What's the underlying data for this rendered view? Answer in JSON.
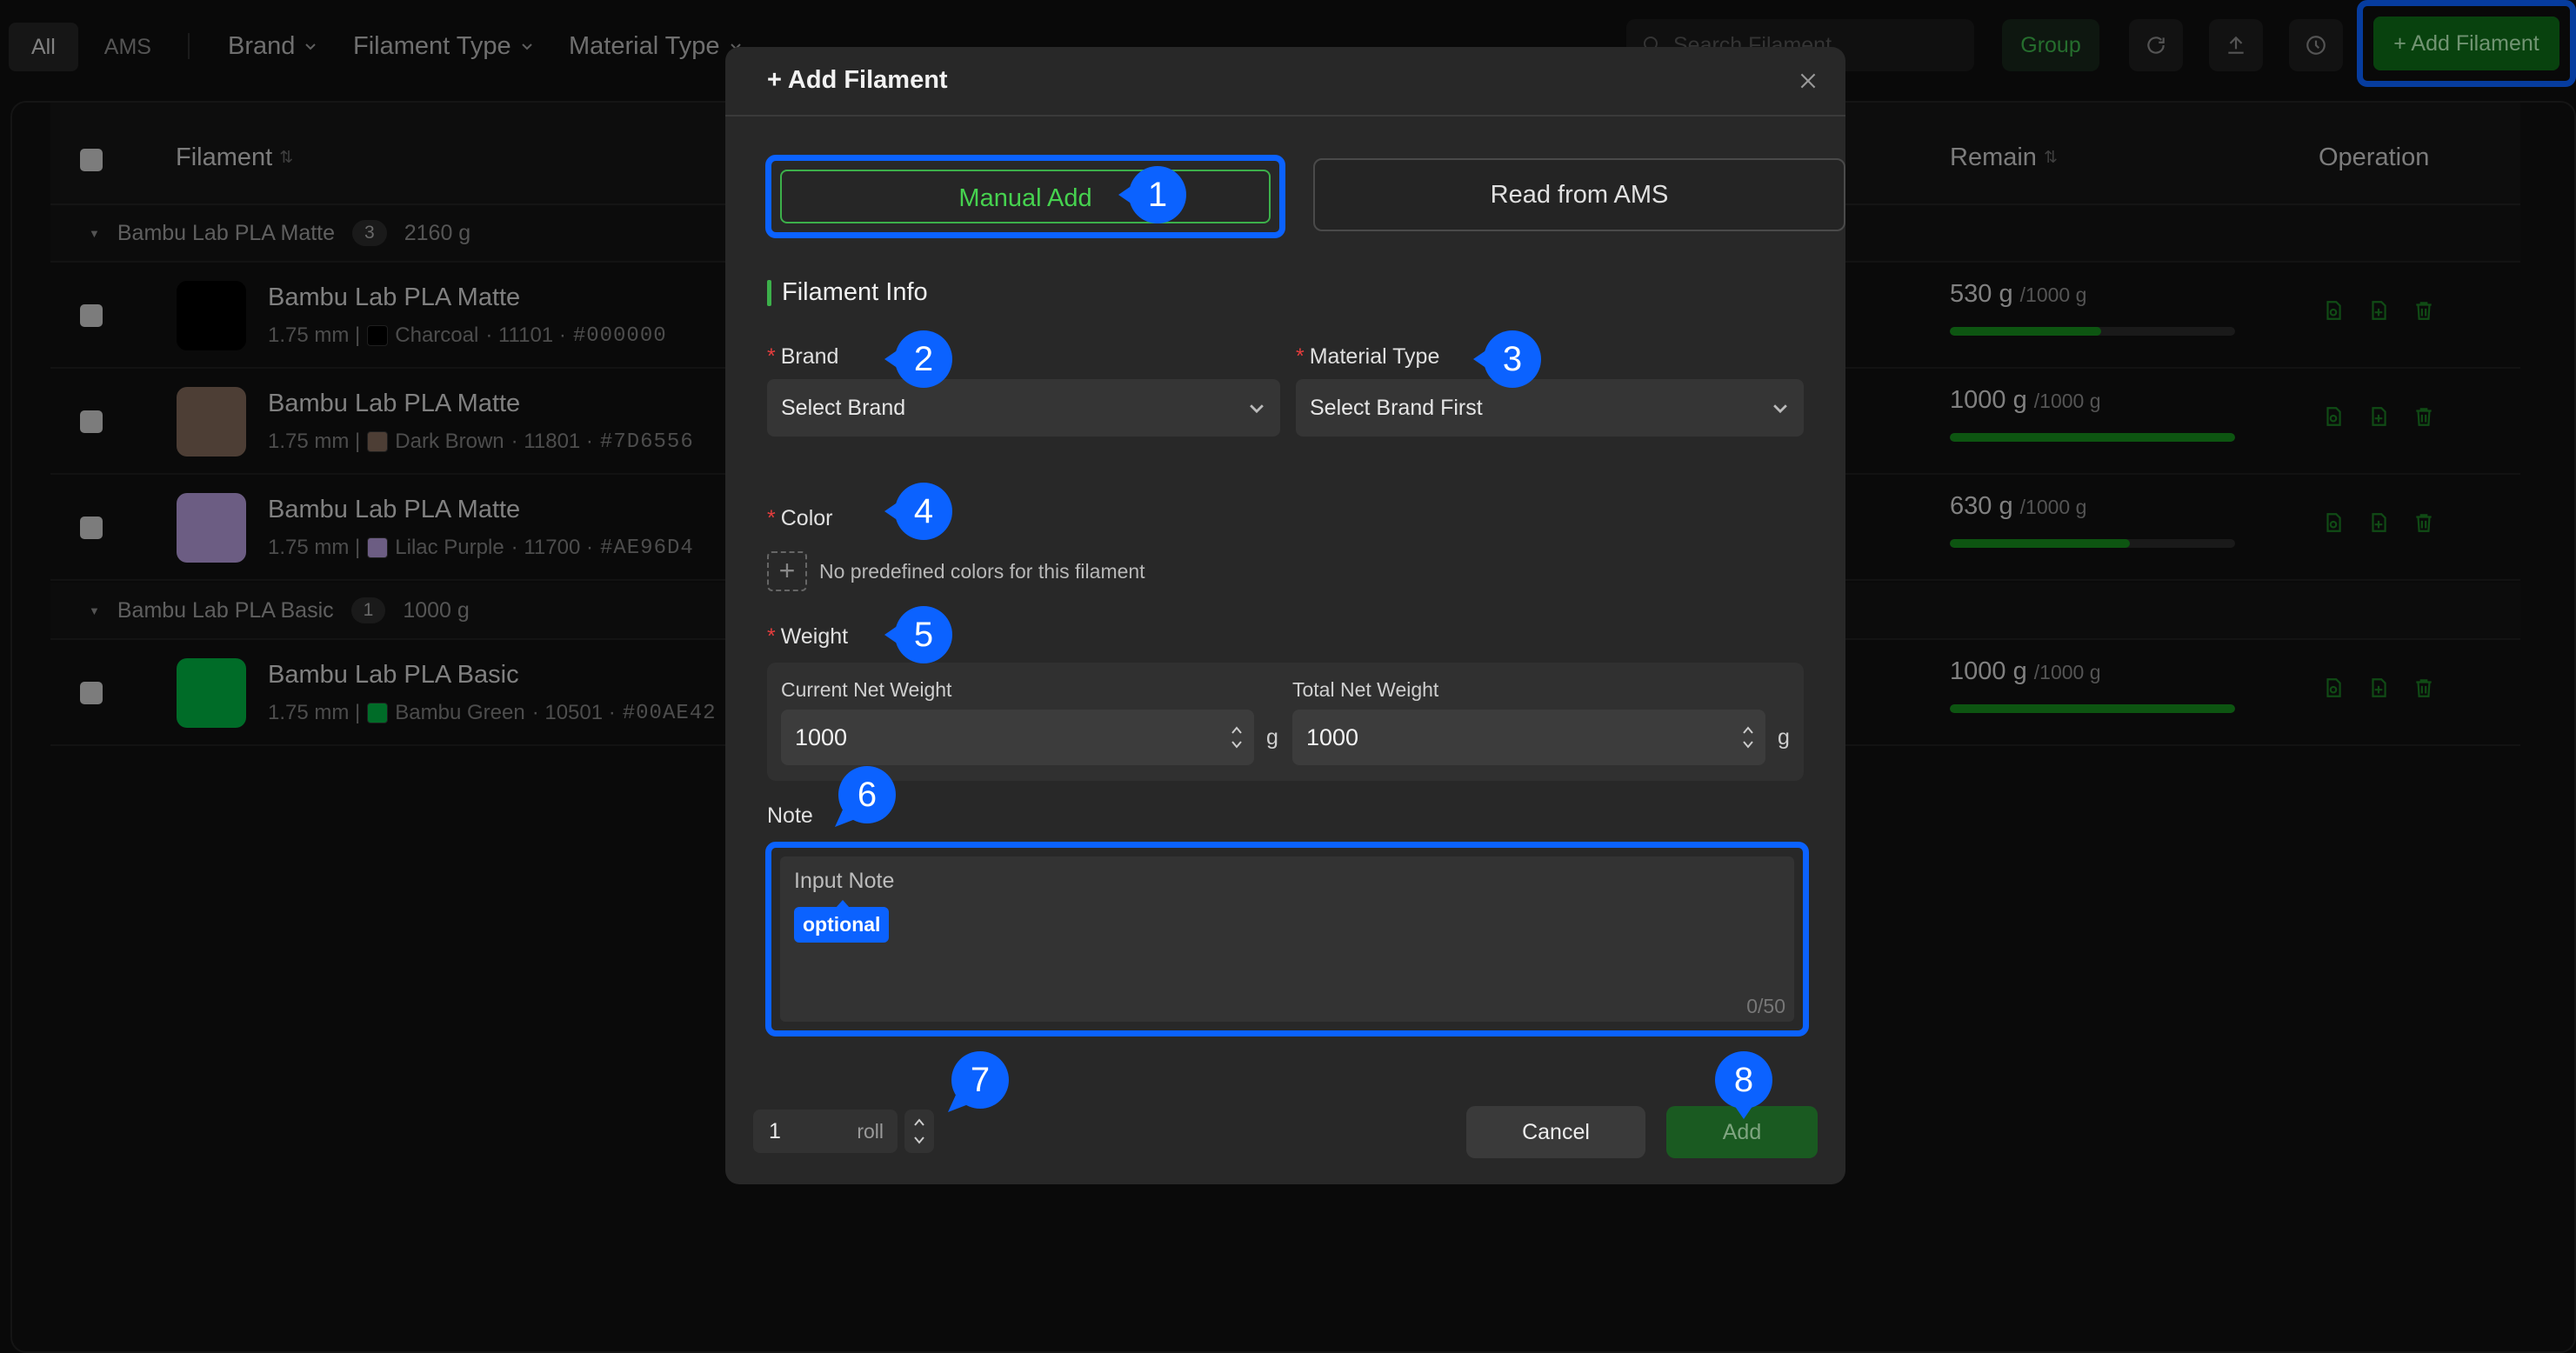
{
  "toolbar": {
    "tabs": [
      {
        "label": "All"
      },
      {
        "label": "AMS"
      }
    ],
    "filters": [
      {
        "label": "Brand"
      },
      {
        "label": "Filament Type"
      },
      {
        "label": "Material Type"
      }
    ],
    "search_placeholder": "Search Filament",
    "group_label": "Group",
    "add_filament_label": "+ Add Filament"
  },
  "table": {
    "headers": {
      "filament": "Filament",
      "remain": "Remain",
      "operation": "Operation"
    },
    "groups": [
      {
        "name": "Bambu Lab PLA Matte",
        "count": "3",
        "total": "2160 g"
      },
      {
        "name": "Bambu Lab PLA Basic",
        "count": "1",
        "total": "1000 g"
      }
    ],
    "rows": [
      {
        "name": "Bambu Lab PLA Matte",
        "diameter": "1.75 mm |",
        "color_name": "Charcoal",
        "code": "· 11101 ·",
        "hex": "#000000",
        "color": "#000000",
        "remain": "530 g",
        "capacity": "/1000 g",
        "fraction": 0.53
      },
      {
        "name": "Bambu Lab PLA Matte",
        "diameter": "1.75 mm |",
        "color_name": "Dark Brown",
        "code": "· 11801 ·",
        "hex": "#7D6556",
        "color": "#7D6556",
        "remain": "1000 g",
        "capacity": "/1000 g",
        "fraction": 1.0
      },
      {
        "name": "Bambu Lab PLA Matte",
        "diameter": "1.75 mm |",
        "color_name": "Lilac Purple",
        "code": "· 11700 ·",
        "hex": "#AE96D4",
        "color": "#AE96D4",
        "remain": "630 g",
        "capacity": "/1000 g",
        "fraction": 0.63
      },
      {
        "name": "Bambu Lab PLA Basic",
        "diameter": "1.75 mm |",
        "color_name": "Bambu Green",
        "code": "· 10501 ·",
        "hex": "#00AE42",
        "color": "#00AE42",
        "remain": "1000 g",
        "capacity": "/1000 g",
        "fraction": 1.0
      }
    ]
  },
  "modal": {
    "title": "+ Add Filament",
    "modes": {
      "manual": "Manual Add",
      "ams": "Read from AMS"
    },
    "section_title": "Filament Info",
    "brand": {
      "label": "Brand",
      "value": "Select Brand"
    },
    "material": {
      "label": "Material Type",
      "value": "Select Brand First"
    },
    "color": {
      "label": "Color",
      "hint": "No predefined colors for this filament"
    },
    "weight": {
      "label": "Weight",
      "current_label": "Current Net Weight",
      "current_value": "1000",
      "total_label": "Total Net Weight",
      "total_value": "1000",
      "unit": "g"
    },
    "note": {
      "label": "Note",
      "placeholder": "Input Note",
      "counter": "0/50",
      "tag": "optional"
    },
    "quantity": {
      "value": "1",
      "unit": "roll"
    },
    "cancel_label": "Cancel",
    "add_label": "Add"
  },
  "callouts": [
    "1",
    "2",
    "3",
    "4",
    "5",
    "6",
    "7",
    "8"
  ],
  "colors": {
    "accent_green": "#3cb04a",
    "highlight_blue": "#0b62ff",
    "required_red": "#e43d3d"
  }
}
